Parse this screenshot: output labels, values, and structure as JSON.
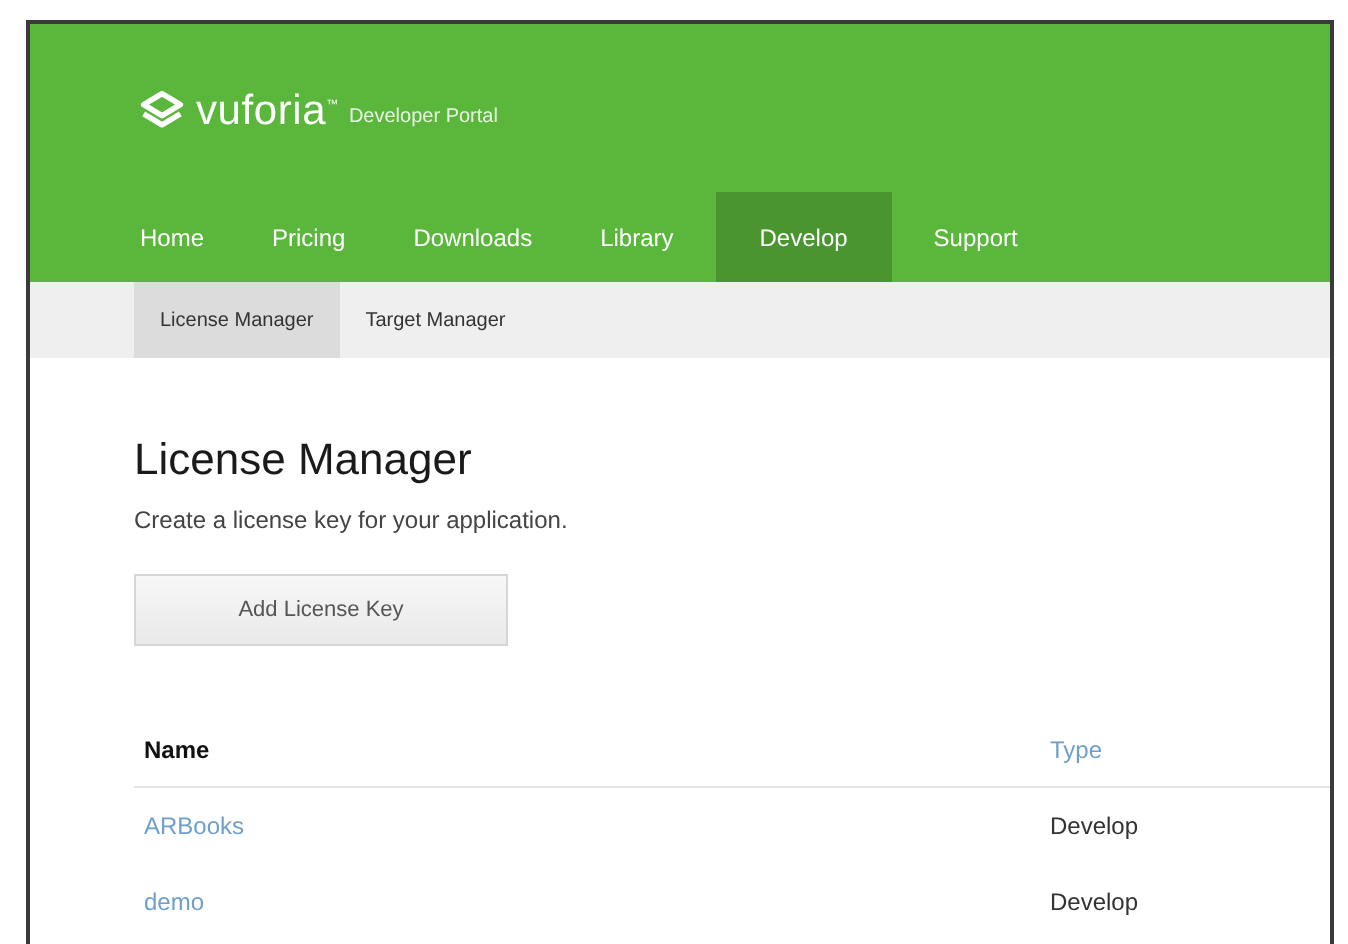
{
  "brand": {
    "name": "vuforia$^{™}$",
    "subtitle": "Developer Portal"
  },
  "nav": [
    {
      "label": "Home",
      "selected": false
    },
    {
      "label": "Pricing",
      "selected": false
    },
    {
      "label": "Downloads",
      "selected": false
    },
    {
      "label": "Library",
      "selected": false
    },
    {
      "label": "Develop",
      "selected": true
    },
    {
      "label": "Support",
      "selected": false
    }
  ],
  "subnav": [
    {
      "label": "License Manager",
      "selected": true
    },
    {
      "label": "Target Manager",
      "selected": false
    }
  ],
  "page": {
    "title": "License Manager",
    "description": "Create a license key for your application.",
    "button": "Add License Key"
  },
  "table": {
    "columns": [
      {
        "label": "Name",
        "link": false
      },
      {
        "label": "Type",
        "link": true
      }
    ],
    "rows": [
      {
        "name": "ARBooks",
        "type": "Develop"
      },
      {
        "name": "demo",
        "type": "Develop"
      }
    ]
  }
}
